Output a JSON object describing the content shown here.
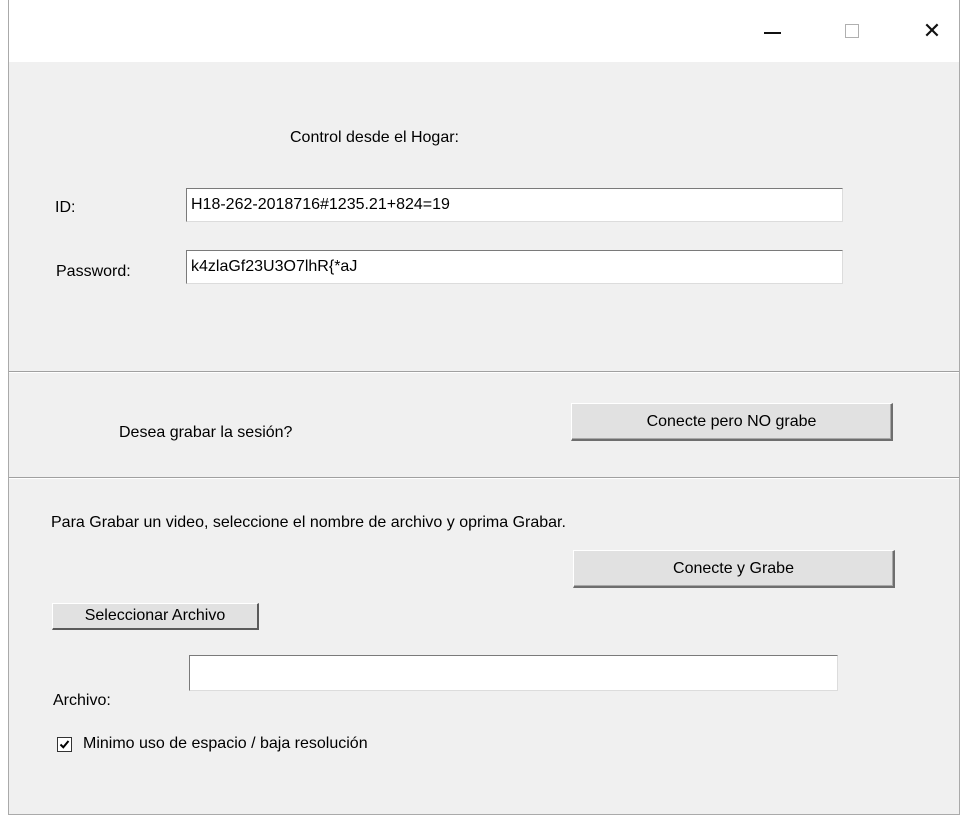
{
  "window": {
    "controls": {
      "minimize_icon": "minimize-icon",
      "maximize_icon": "maximize-icon",
      "close_icon": "close-icon",
      "close_glyph": "✕"
    }
  },
  "header": {
    "title": "Control desde el Hogar:"
  },
  "credentials": {
    "id_label": "ID:",
    "id_value": "H18-262-2018716#1235.21+824=19",
    "password_label": "Password:",
    "password_value": "k4zlaGf23U3O7lhR{*aJ"
  },
  "record_prompt": {
    "question": "Desea grabar la sesión?",
    "connect_no_record_label": "Conecte pero NO grabe"
  },
  "record_section": {
    "instructions": "Para Grabar un video, seleccione el nombre de archivo y oprima Grabar.",
    "connect_record_label": "Conecte y Grabe",
    "select_file_label": "Seleccionar Archivo",
    "file_label": "Archivo:",
    "file_value": "",
    "low_res_label": "Minimo uso de espacio / baja resolución",
    "low_res_checked": true
  }
}
